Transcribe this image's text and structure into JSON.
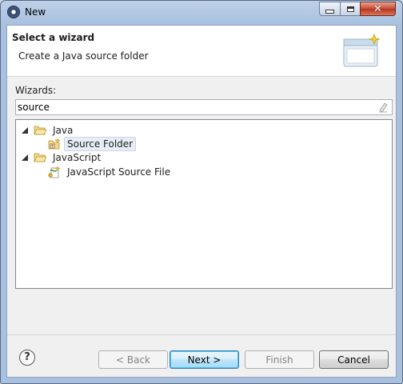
{
  "window": {
    "title": "New"
  },
  "header": {
    "title": "Select a wizard",
    "description": "Create a Java source folder"
  },
  "wizards": {
    "label": "Wizards:",
    "filter_value": "source"
  },
  "tree": {
    "nodes": [
      {
        "label": "Java",
        "type": "folder",
        "expanded": true,
        "children": [
          {
            "label": "Source Folder",
            "icon": "java-source-folder-icon",
            "selected": true
          }
        ]
      },
      {
        "label": "JavaScript",
        "type": "folder",
        "expanded": true,
        "children": [
          {
            "label": "JavaScript Source File",
            "icon": "javascript-source-file-icon",
            "selected": false
          }
        ]
      }
    ]
  },
  "buttons": {
    "back": "< Back",
    "next": "Next >",
    "finish": "Finish",
    "cancel": "Cancel"
  },
  "colors": {
    "title_bar": "#a9c1df",
    "dialog_bg": "#f0f0f0",
    "default_button": "#bee6fd",
    "close_button": "#c74a32"
  }
}
